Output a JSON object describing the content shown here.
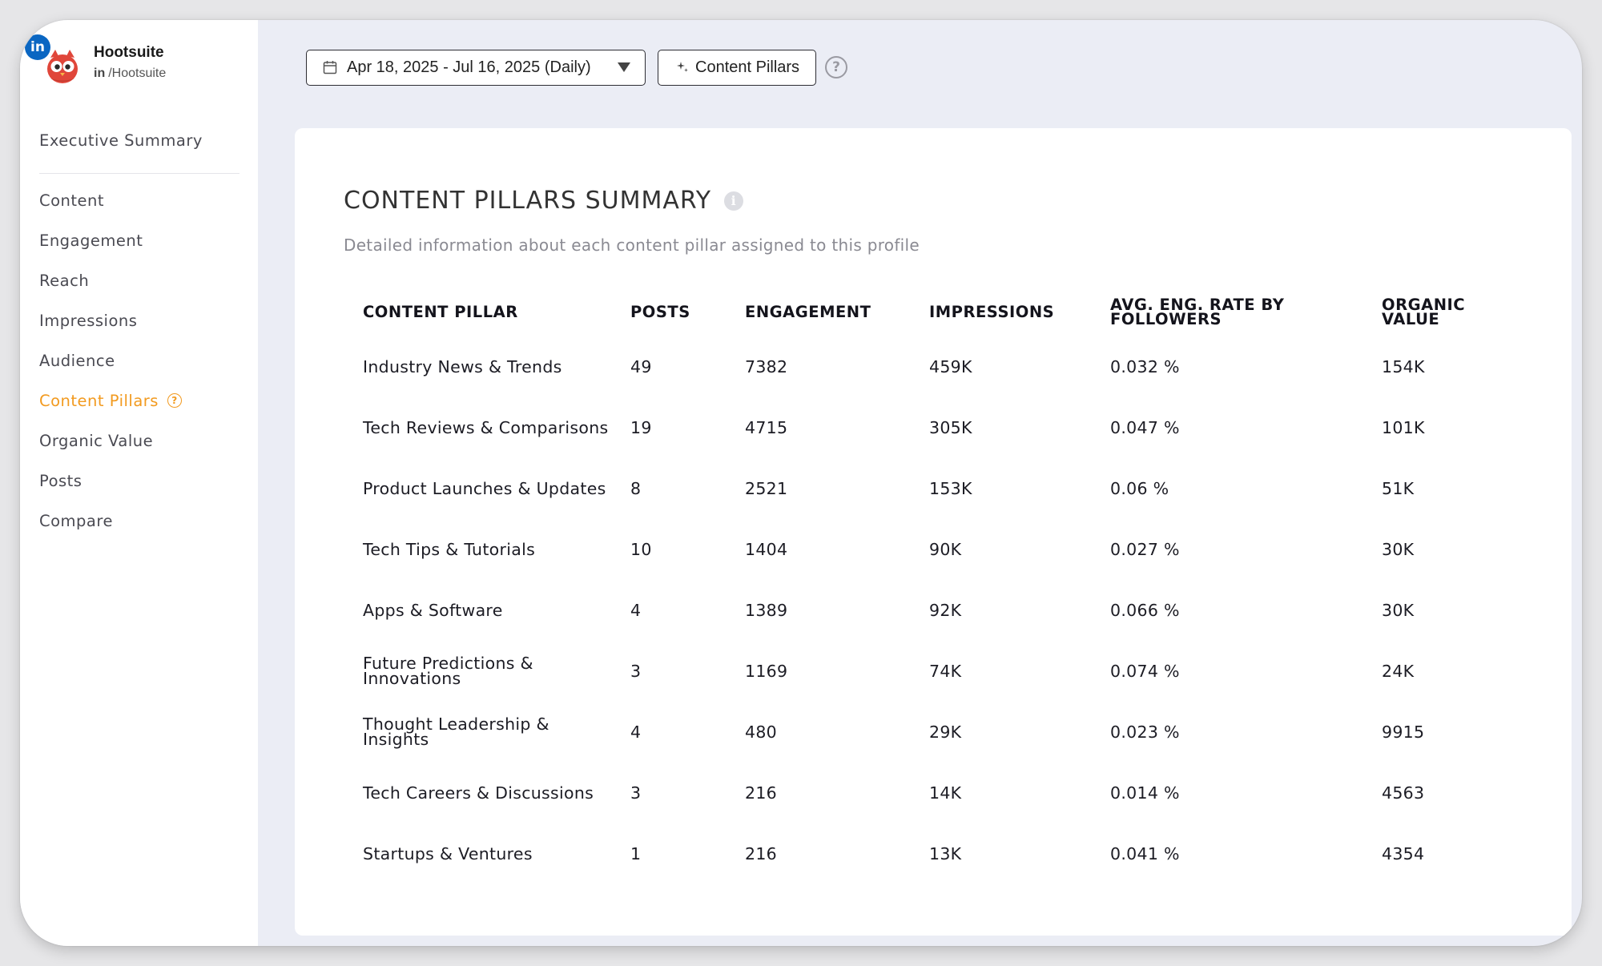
{
  "profile": {
    "name": "Hootsuite",
    "network_badge": "in",
    "handle_prefix": "in",
    "handle": "/Hootsuite"
  },
  "sidebar": {
    "items": [
      {
        "label": "Executive Summary"
      },
      {
        "label": "Content"
      },
      {
        "label": "Engagement"
      },
      {
        "label": "Reach"
      },
      {
        "label": "Impressions"
      },
      {
        "label": "Audience"
      },
      {
        "label": "Content Pillars",
        "active": true
      },
      {
        "label": "Organic Value"
      },
      {
        "label": "Posts"
      },
      {
        "label": "Compare"
      }
    ],
    "help_glyph": "?"
  },
  "toolbar": {
    "date_range": "Apr 18, 2025 - Jul 16, 2025 (Daily)",
    "pillars_button": "Content Pillars",
    "help_glyph": "?"
  },
  "main": {
    "title": "CONTENT PILLARS SUMMARY",
    "info_glyph": "i",
    "subtitle": "Detailed information about each content pillar assigned to this profile",
    "table": {
      "headers": [
        "CONTENT PILLAR",
        "POSTS",
        "ENGAGEMENT",
        "IMPRESSIONS",
        "AVG. ENG. RATE BY FOLLOWERS",
        "ORGANIC VALUE"
      ],
      "rows": [
        [
          "Industry News & Trends",
          "49",
          "7382",
          "459K",
          "0.032 %",
          "154K"
        ],
        [
          "Tech Reviews & Comparisons",
          "19",
          "4715",
          "305K",
          "0.047 %",
          "101K"
        ],
        [
          "Product Launches & Updates",
          "8",
          "2521",
          "153K",
          "0.06 %",
          "51K"
        ],
        [
          "Tech Tips & Tutorials",
          "10",
          "1404",
          "90K",
          "0.027 %",
          "30K"
        ],
        [
          "Apps & Software",
          "4",
          "1389",
          "92K",
          "0.066 %",
          "30K"
        ],
        [
          "Future Predictions & Innovations",
          "3",
          "1169",
          "74K",
          "0.074 %",
          "24K"
        ],
        [
          "Thought Leadership & Insights",
          "4",
          "480",
          "29K",
          "0.023 %",
          "9915"
        ],
        [
          "Tech Careers & Discussions",
          "3",
          "216",
          "14K",
          "0.014 %",
          "4563"
        ],
        [
          "Startups & Ventures",
          "1",
          "216",
          "13K",
          "0.041 %",
          "4354"
        ]
      ]
    }
  },
  "colors": {
    "accent": "#f29a1f",
    "linkedin": "#0a66c2",
    "background": "#ebedf5"
  }
}
